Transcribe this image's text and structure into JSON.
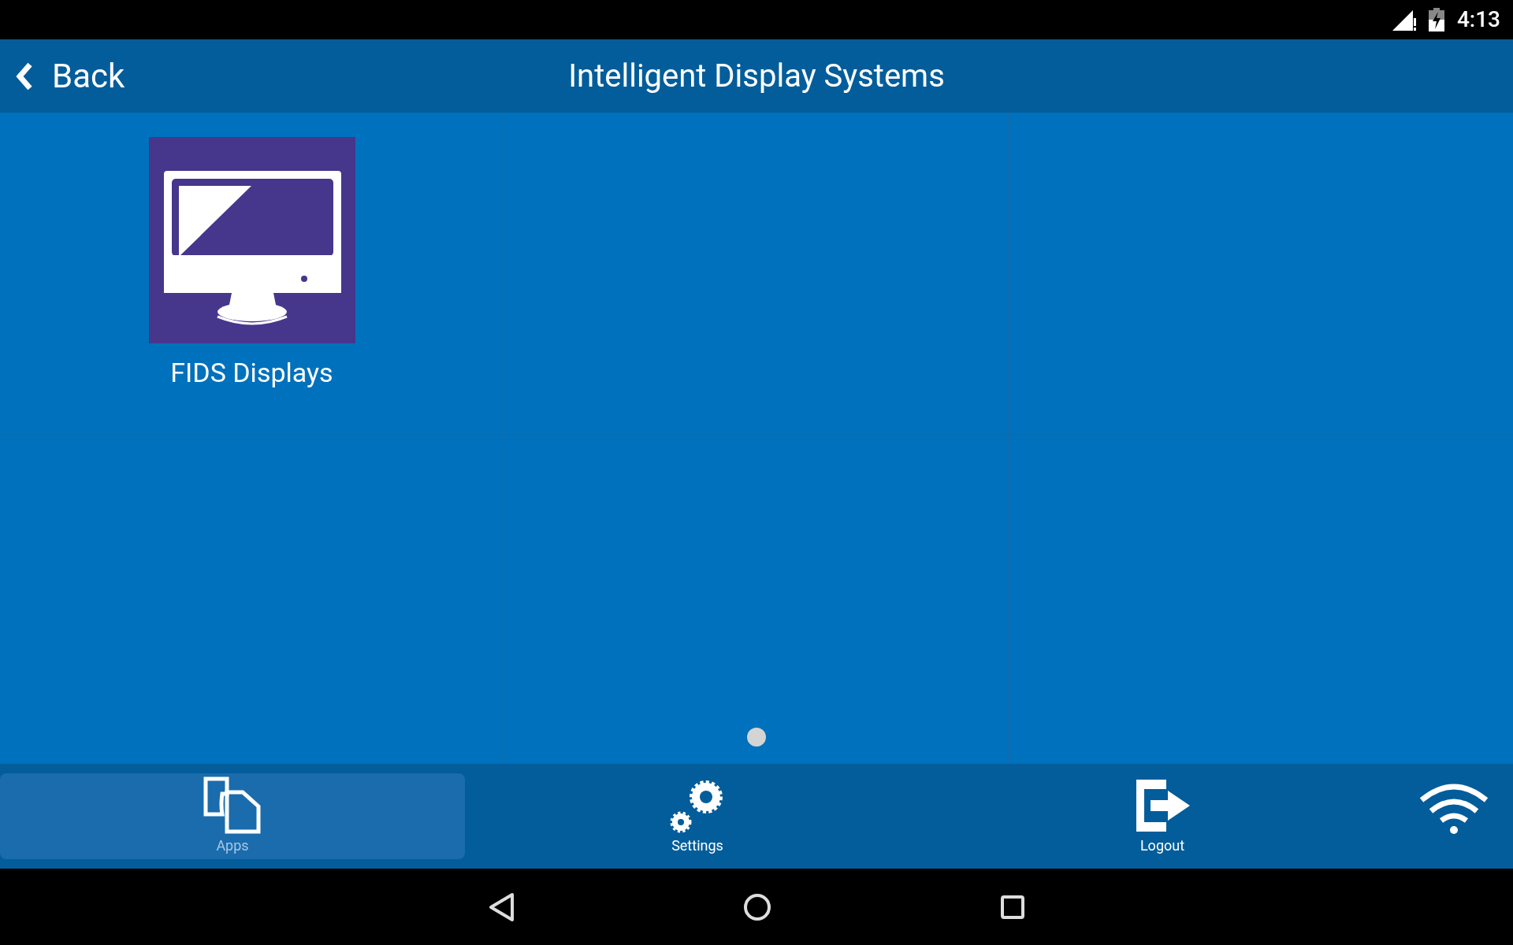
{
  "status_bar": {
    "time": "4:13"
  },
  "header": {
    "back_label": "Back",
    "title": "Intelligent Display Systems"
  },
  "apps": [
    {
      "label": "FIDS Displays"
    }
  ],
  "pages": [
    {
      "selected": true
    }
  ],
  "tabs": [
    {
      "kind": "apps",
      "label": "Apps",
      "selected": true
    },
    {
      "kind": "settings",
      "label": "Settings",
      "selected": false
    },
    {
      "kind": "logout",
      "label": "Logout",
      "selected": false
    }
  ]
}
